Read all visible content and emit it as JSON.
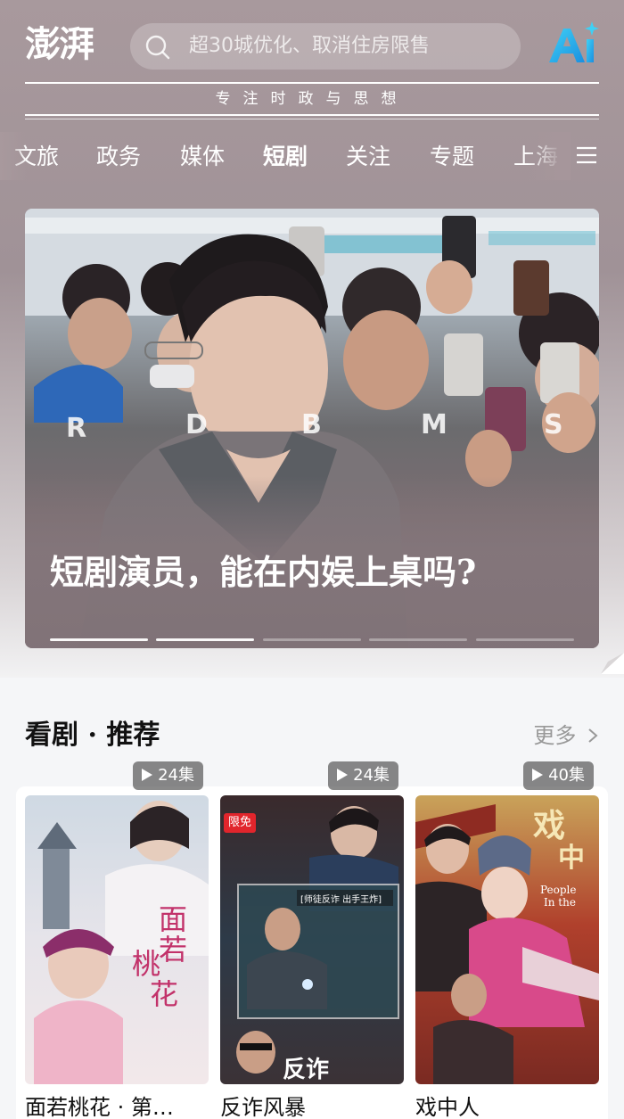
{
  "header": {
    "logo_text": "澎湃",
    "search_placeholder": "超30城优化、取消住房限售",
    "ai_label": "AI",
    "tagline": "专注时政与思想"
  },
  "tabs": [
    {
      "label": "文旅",
      "active": false
    },
    {
      "label": "政务",
      "active": false
    },
    {
      "label": "媒体",
      "active": false
    },
    {
      "label": "短剧",
      "active": true
    },
    {
      "label": "关注",
      "active": false
    },
    {
      "label": "专题",
      "active": false
    },
    {
      "label": "上海",
      "active": false
    }
  ],
  "hero": {
    "title": "短剧演员，能在内娱上桌吗?",
    "slides_total": 5,
    "slide_index_active": 1
  },
  "section": {
    "title": "看剧 · 推荐",
    "more_label": "更多"
  },
  "cards": [
    {
      "title": "面若桃花 · 第…",
      "episodes": "24集",
      "badge": ""
    },
    {
      "title": "反诈风暴",
      "episodes": "24集",
      "badge": "限免"
    },
    {
      "title": "戏中人",
      "episodes": "40集",
      "badge": ""
    }
  ],
  "colors": {
    "header_bg": "#a8999d",
    "ai_accent": "#1fb6e8",
    "badge_red": "#e1252c"
  }
}
